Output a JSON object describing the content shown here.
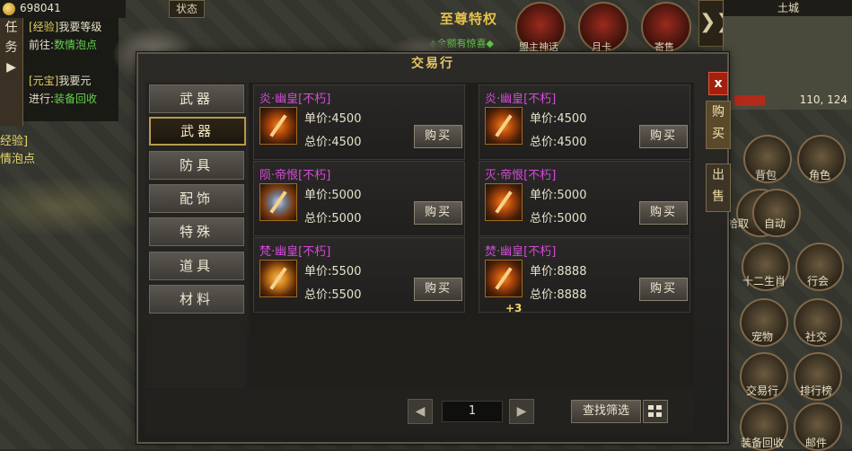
{
  "hud": {
    "gold": "698041",
    "status_button": "状态",
    "quest_tab": [
      "任",
      "务"
    ],
    "quests": [
      {
        "tag": "[经验]",
        "text": "我要等级"
      },
      {
        "prefix": "前往:",
        "link": "数情泡点"
      },
      {
        "tag": "[元宝]",
        "text": "我要元"
      },
      {
        "prefix": "进行:",
        "link": "装备回收"
      }
    ],
    "left_labels": [
      "经验]",
      "情泡点"
    ],
    "event_title": "至尊特权",
    "event_subtitle": "◆余额有惊喜◆",
    "top_icons": [
      {
        "name": "mentor-icon",
        "label": "盟主神话"
      },
      {
        "name": "monthly-card-icon",
        "label": "月卡"
      },
      {
        "name": "sell-icon",
        "label": "寄售"
      }
    ],
    "expand_arrow": "❯❯",
    "minimap": {
      "title": "土城",
      "coords": "110, 124"
    },
    "side_icons": [
      {
        "name": "backpack-icon",
        "label": "背包"
      },
      {
        "name": "character-icon",
        "label": "角色"
      },
      {
        "name": "skill-icon",
        "label": "拾取"
      },
      {
        "name": "auto-icon",
        "label": "自动"
      },
      {
        "name": "zodiac-icon",
        "label": "十二生肖"
      },
      {
        "name": "guild-icon",
        "label": "行会"
      },
      {
        "name": "pet-icon",
        "label": "宠物"
      },
      {
        "name": "social-icon",
        "label": "社交"
      },
      {
        "name": "trade-icon",
        "label": "交易行"
      },
      {
        "name": "ranking-icon",
        "label": "排行榜"
      },
      {
        "name": "gear-recycle-icon",
        "label": "装备回收"
      },
      {
        "name": "mail-icon",
        "label": "邮件"
      }
    ]
  },
  "trade": {
    "title": "交易行",
    "close_label": "x",
    "side_tabs": [
      {
        "label": [
          "购",
          "买"
        ],
        "active": true
      },
      {
        "label": [
          "出",
          "售"
        ],
        "active": false
      }
    ],
    "categories": [
      "武器",
      "武器",
      "防具",
      "配饰",
      "特殊",
      "道具",
      "材料"
    ],
    "active_category": 1,
    "unit_price_label": "单价:",
    "total_price_label": "总价:",
    "buy_label": "购买",
    "items": [
      {
        "name": "炎·幽皇[不朽]",
        "unit": "4500",
        "total": "4500",
        "icon": "fire-sword-icon",
        "enh": ""
      },
      {
        "name": "炎·幽皇[不朽]",
        "unit": "4500",
        "total": "4500",
        "icon": "fire-sword-icon",
        "enh": ""
      },
      {
        "name": "陨·帝恨[不朽]",
        "unit": "5000",
        "total": "5000",
        "icon": "battle-axe-icon",
        "enh": ""
      },
      {
        "name": "灭·帝恨[不朽]",
        "unit": "5000",
        "total": "5000",
        "icon": "trident-icon",
        "enh": ""
      },
      {
        "name": "梵·幽皇[不朽]",
        "unit": "5500",
        "total": "5500",
        "icon": "fan-blade-icon",
        "enh": ""
      },
      {
        "name": "焚·幽皇[不朽]",
        "unit": "8888",
        "total": "8888",
        "icon": "flame-sword-icon",
        "enh": "+3"
      }
    ],
    "page": "1",
    "filter_label": "查找筛选"
  }
}
